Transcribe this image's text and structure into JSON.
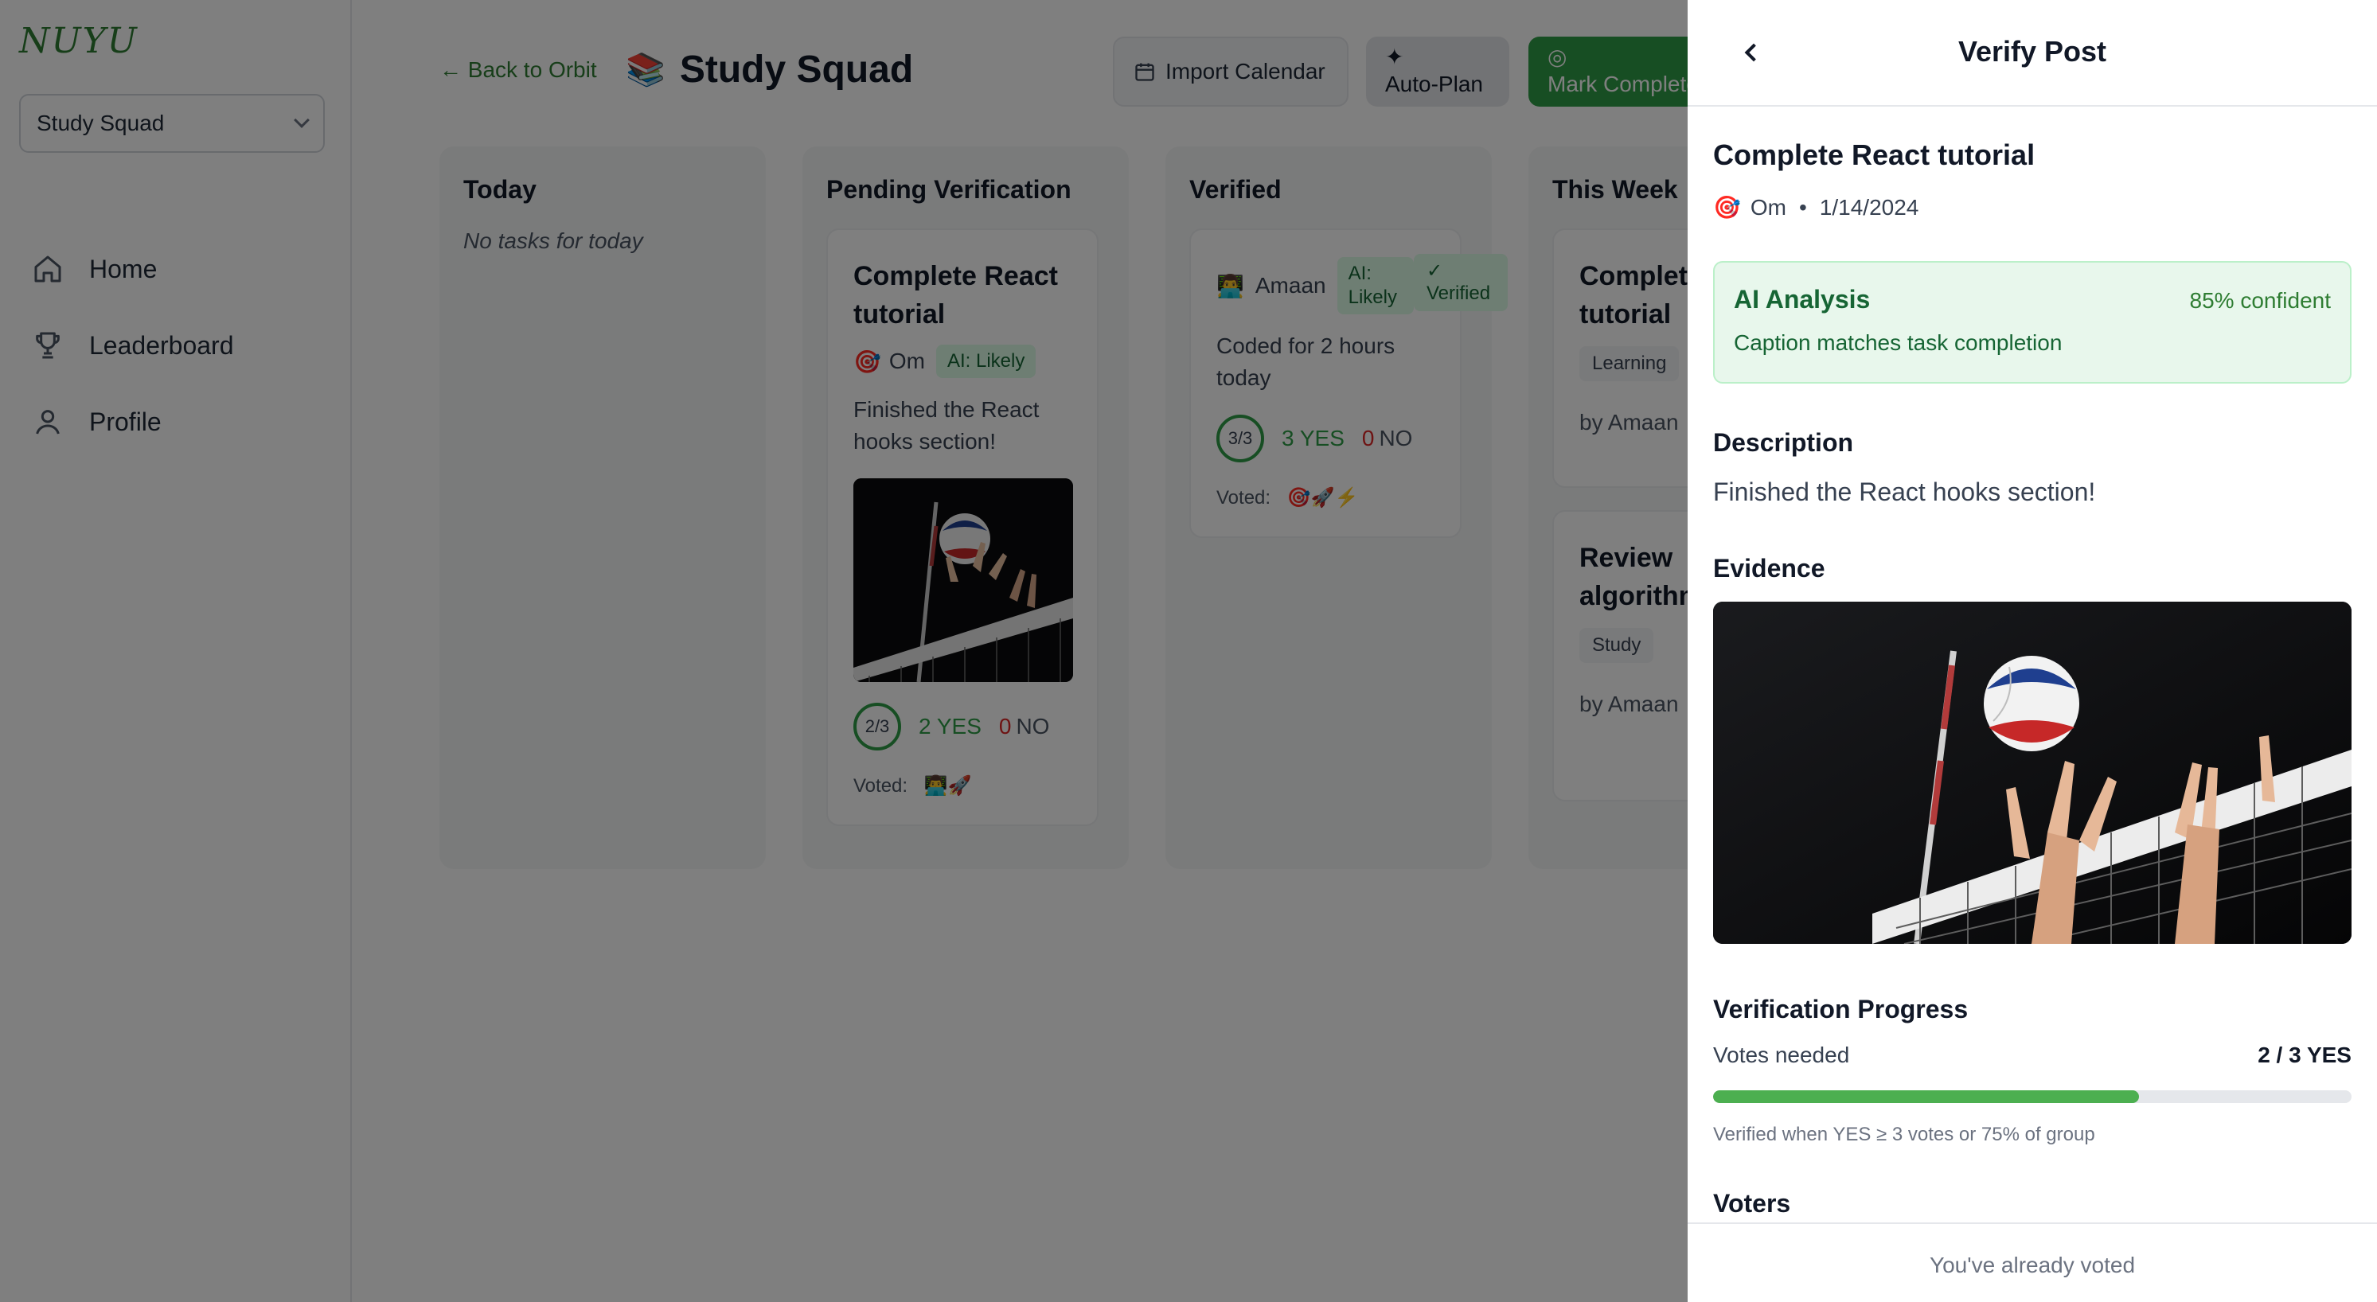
{
  "app": {
    "logo": "NUYU",
    "group_select": "Study Squad"
  },
  "sidebar": {
    "items": [
      {
        "label": "Home",
        "icon": "home-icon"
      },
      {
        "label": "Leaderboard",
        "icon": "trophy-icon"
      },
      {
        "label": "Profile",
        "icon": "user-icon"
      }
    ]
  },
  "header": {
    "back_link": "← Back to Orbit",
    "title_emoji": "📚",
    "title": "Study Squad",
    "import_label": "Import Calendar",
    "autoplan_label": "Auto-Plan",
    "mark_label": "Mark Complete"
  },
  "columns": {
    "today": {
      "title": "Today",
      "empty": "No tasks for today"
    },
    "pending": {
      "title": "Pending Verification",
      "card": {
        "title": "Complete React tutorial",
        "user_emoji": "🎯",
        "user": "Om",
        "ai_badge": "AI: Likely",
        "desc": "Finished the React hooks section!",
        "ring": "2/3",
        "yes": "2 YES",
        "no_num": "0",
        "no": "NO",
        "voted_label": "Voted:",
        "voted_emojis": "👨‍💻🚀"
      }
    },
    "verified": {
      "title": "Verified",
      "card": {
        "user_emoji": "👨‍💻",
        "user": "Amaan",
        "ai_badge": "AI: Likely",
        "verified_badge": "✓ Verified",
        "desc": "Coded for 2 hours today",
        "ring": "3/3",
        "yes": "3 YES",
        "no_num": "0",
        "no": "NO",
        "voted_label": "Voted:",
        "voted_emojis": "🎯🚀⚡"
      }
    },
    "week": {
      "title": "This Week",
      "cards": [
        {
          "title": "Complete React tutorial",
          "tag": "Learning",
          "by": "by Amaan"
        },
        {
          "title": "Review algorithms",
          "tag": "Study",
          "by": "by Amaan"
        }
      ]
    }
  },
  "drawer": {
    "title": "Verify Post",
    "post_title": "Complete React tutorial",
    "user_emoji": "🎯",
    "user": "Om",
    "sep": "•",
    "date": "1/14/2024",
    "ai": {
      "title": "AI Analysis",
      "confidence": "85% confident",
      "reason": "Caption matches task completion"
    },
    "description_heading": "Description",
    "description": "Finished the React hooks section!",
    "evidence_heading": "Evidence",
    "progress_heading": "Verification Progress",
    "votes_needed_label": "Votes needed",
    "votes_value": "2 / 3 YES",
    "progress_fraction": 0.667,
    "rule": "Verified when YES ≥ 3 votes or 75% of group",
    "voters_heading": "Voters",
    "footer": "You've already voted"
  },
  "colors": {
    "accent": "#2e9d47",
    "brand": "#2e7d32",
    "no": "#dc2626"
  }
}
